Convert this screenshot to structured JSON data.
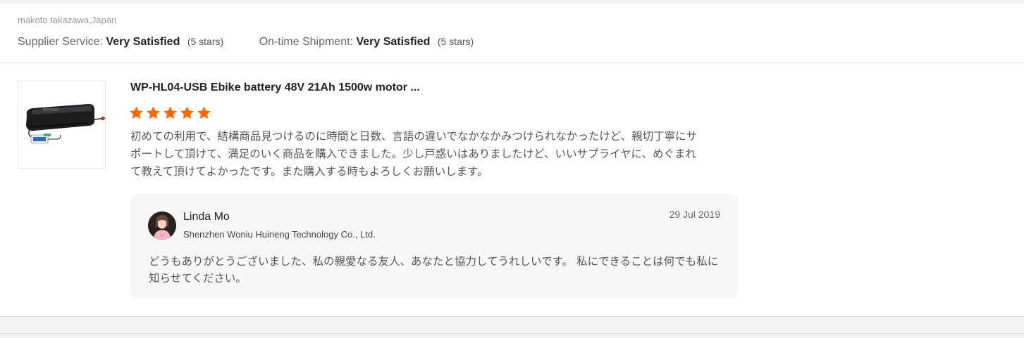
{
  "review": {
    "reviewer": "makoto takazawa,Japan",
    "ratings": [
      {
        "label": "Supplier Service:",
        "value": "Very Satisfied",
        "stars": "(5 stars)"
      },
      {
        "label": "On-time Shipment:",
        "value": "Very Satisfied",
        "stars": "(5 stars)"
      }
    ],
    "product": {
      "title": "WP-HL04-USB Ebike battery 48V 21Ah 1500w motor ...",
      "image_icon": "ebike-battery-image",
      "rating": 5,
      "star_color": "#ff6a00"
    },
    "text": "初めての利用で、結構商品見つけるのに時間と日数、言語の違いでなかなかみつけられなかったけど、親切丁寧にサポートして頂けて、満足のいく商品を購入できました。少し戸惑いはありましたけど、いいサプライヤに、めぐまれて教えて頂けてよかったです。また購入する時もよろしくお願いします。"
  },
  "reply": {
    "name": "Linda Mo",
    "company": "Shenzhen Woniu Huineng Technology Co., Ltd.",
    "date": "29 Jul 2019",
    "text": "どうもありがとうございました、私の親愛なる友人、あなたと協力してうれしいです。 私にできることは何でも私に知らせてください。"
  }
}
